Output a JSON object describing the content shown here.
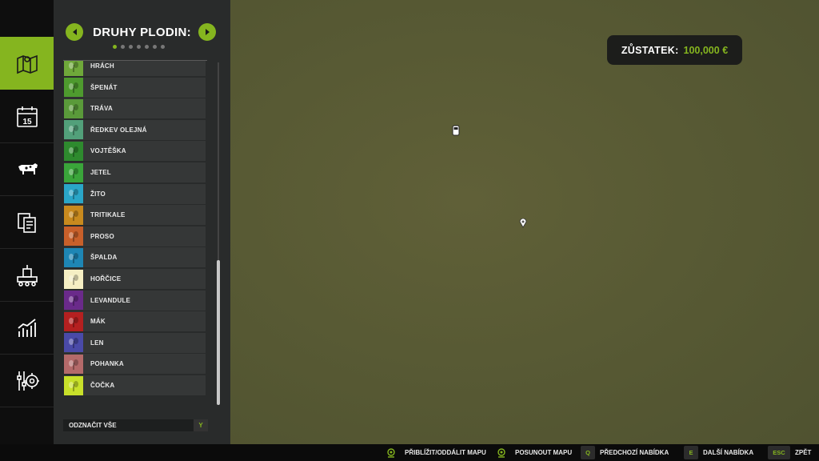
{
  "panel": {
    "title": "DRUHY PLODIN:",
    "page_dots_total": 7,
    "page_dots_active": 1
  },
  "nav": {
    "items": [
      {
        "name": "map-icon",
        "active": true
      },
      {
        "name": "calendar-icon",
        "text": "15",
        "active": false
      },
      {
        "name": "cow-icon",
        "active": false
      },
      {
        "name": "contracts-icon",
        "active": false
      },
      {
        "name": "production-icon",
        "active": false
      },
      {
        "name": "statistics-icon",
        "active": false
      },
      {
        "name": "settings-icon",
        "active": false
      }
    ]
  },
  "crops": [
    {
      "label": "HRÁCH",
      "color": "#6fa83a"
    },
    {
      "label": "ŠPENÁT",
      "color": "#4e9a2e"
    },
    {
      "label": "TRÁVA",
      "color": "#5a9a3a"
    },
    {
      "label": "ŘEDKEV OLEJNÁ",
      "color": "#52a07a"
    },
    {
      "label": "VOJTĚŠKA",
      "color": "#2e8a2e"
    },
    {
      "label": "JETEL",
      "color": "#3aa53a"
    },
    {
      "label": "ŽITO",
      "color": "#2aa6c8"
    },
    {
      "label": "TRITIKALE",
      "color": "#c88a1e"
    },
    {
      "label": "PROSO",
      "color": "#c8602a"
    },
    {
      "label": "ŠPALDA",
      "color": "#1e86b4"
    },
    {
      "label": "HOŘČICE",
      "color": "#f5efc4"
    },
    {
      "label": "LEVANDULE",
      "color": "#6a2a8a"
    },
    {
      "label": "MÁK",
      "color": "#b42020"
    },
    {
      "label": "LEN",
      "color": "#4a4aa8"
    },
    {
      "label": "POHANKA",
      "color": "#b46a6a"
    },
    {
      "label": "ČOČKA",
      "color": "#c8e02a"
    }
  ],
  "select_all": {
    "label": "ODZNAČIT VŠE",
    "key": "Y"
  },
  "balance": {
    "label": "ZŮSTATEK:",
    "value": "100,000 €"
  },
  "hints": [
    {
      "key": "",
      "icon": "joystick-icon",
      "label": "PŘIBLÍŽIT/ODDÁLIT MAPU"
    },
    {
      "key": "",
      "icon": "joystick-icon",
      "label": "POSUNOUT MAPU"
    },
    {
      "key": "Q",
      "label": "PŘEDCHOZÍ NABÍDKA"
    },
    {
      "key": "E",
      "label": "DALŠÍ NABÍDKA"
    },
    {
      "key": "ESC",
      "label": "ZPĚT"
    }
  ],
  "colors": {
    "accent": "#85b51f"
  }
}
